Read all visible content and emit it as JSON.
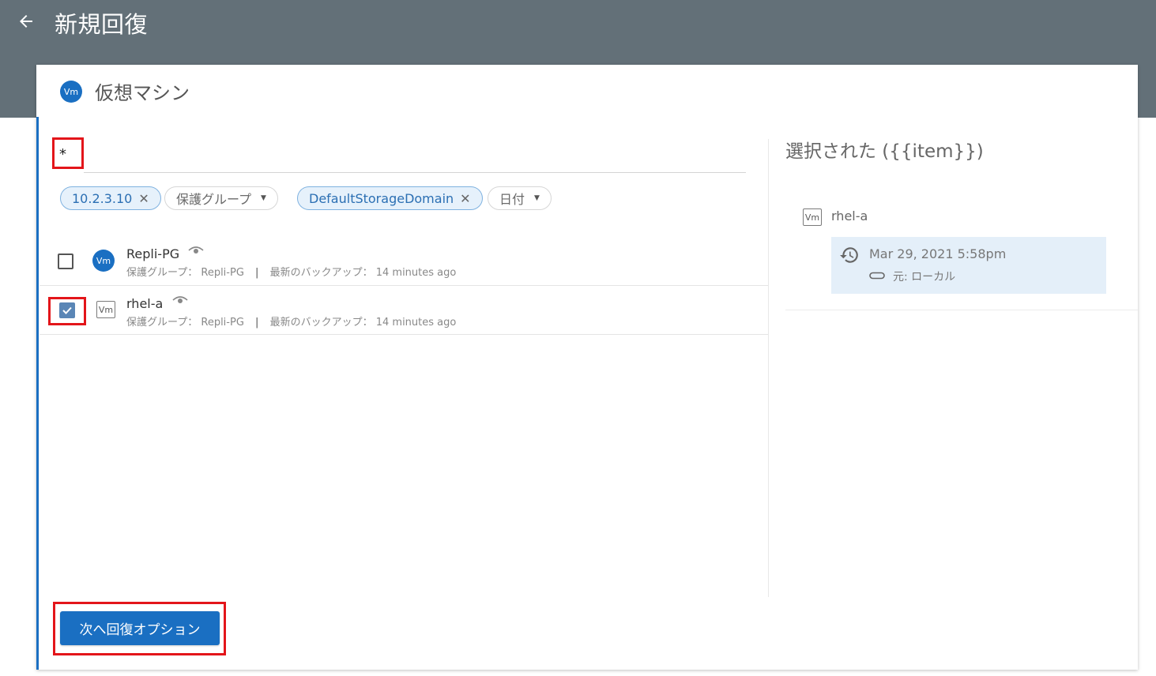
{
  "header": {
    "title": "新規回復"
  },
  "section": {
    "title": "仮想マシン",
    "badge": "Vm"
  },
  "search": {
    "value": "*"
  },
  "filters": [
    {
      "label": "10.2.3.10",
      "active": true,
      "removable": true
    },
    {
      "label": "保護グループ",
      "active": false,
      "dropdown": true
    },
    {
      "label": "DefaultStorageDomain",
      "active": true,
      "removable": true
    },
    {
      "label": "日付",
      "active": false,
      "dropdown": true
    }
  ],
  "rows": [
    {
      "name": "Repli-PG",
      "badge": "Vm",
      "checked": false,
      "meta_group_label": "保護グループ：",
      "meta_group_value": "Repli-PG",
      "meta_backup_label": "最新のバックアップ：",
      "meta_backup_value": "14 minutes ago"
    },
    {
      "name": "rhel-a",
      "badge": "Vm",
      "checked": true,
      "meta_group_label": "保護グループ：",
      "meta_group_value": "Repli-PG",
      "meta_backup_label": "最新のバックアップ：",
      "meta_backup_value": "14 minutes ago"
    }
  ],
  "selected": {
    "title": "選択された ({{item}})",
    "item_badge": "Vm",
    "item_name": "rhel-a",
    "backup_date": "Mar 29, 2021 5:58pm",
    "backup_source": "元: ローカル"
  },
  "footer": {
    "next_label": "次へ回復オプション"
  },
  "colors": {
    "topbar": "#637078",
    "accent": "#1a6fc2",
    "highlight": "#e3151a",
    "selected_card": "#e4eff9"
  },
  "icons": [
    "back-arrow-icon",
    "close-icon",
    "caret-down-icon",
    "eye-icon",
    "check-icon",
    "history-icon",
    "link-icon"
  ]
}
